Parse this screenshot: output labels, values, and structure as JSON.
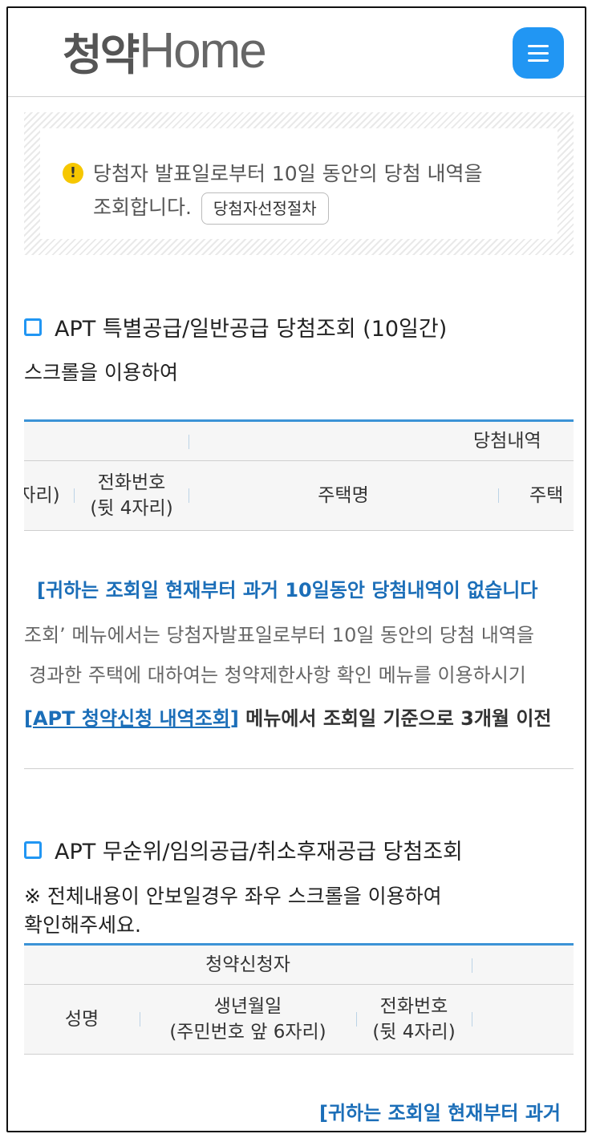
{
  "header": {
    "logo_kr": "청약",
    "logo_en": "Home",
    "menu_label": "☰"
  },
  "notice": {
    "line1": "당첨자 발표일로부터 10일 동안의 당첨 내역을",
    "line2": "조회합니다.",
    "button": "당첨자선정절차"
  },
  "section1": {
    "title": "APT 특별공급/일반공급 당첨조회 (10일간)",
    "subtitle": "스크롤을 이용하여",
    "table": {
      "group_header": "당첨내역",
      "columns": [
        "자리)",
        "전화번호",
        "(뒷 4자리)",
        "주택명",
        "주택"
      ]
    },
    "messages": {
      "none": "[귀하는 조회일 현재부터 과거 10일동안 당첨내역이 없습니다",
      "info1": "조회’ 메뉴에서는 당첨자발표일로부터 10일 동안의 당첨 내역을",
      "info2": "경과한 주택에 대하여는 청약제한사항 확인 메뉴를 이용하시기",
      "link": "APT 청약신청 내역조회",
      "link_prefix": "[",
      "link_suffix": "]",
      "after_link": " 메뉴에서 조회일 기준으로 3개월 이전"
    }
  },
  "section2": {
    "title": "APT 무순위/임의공급/취소후재공급 당첨조회",
    "subtitle_line1": "※ 전체내용이 안보일경우 좌우 스크롤을 이용하여",
    "subtitle_line2": "확인해주세요.",
    "table": {
      "group_header": "청약신청자",
      "col_name": "성명",
      "col_birth1": "생년월일",
      "col_birth2": "(주민번호 앞 6자리)",
      "col_phone1": "전화번호",
      "col_phone2": "(뒷 4자리)"
    },
    "message": "[귀하는 조회일 현재부터 과거"
  }
}
